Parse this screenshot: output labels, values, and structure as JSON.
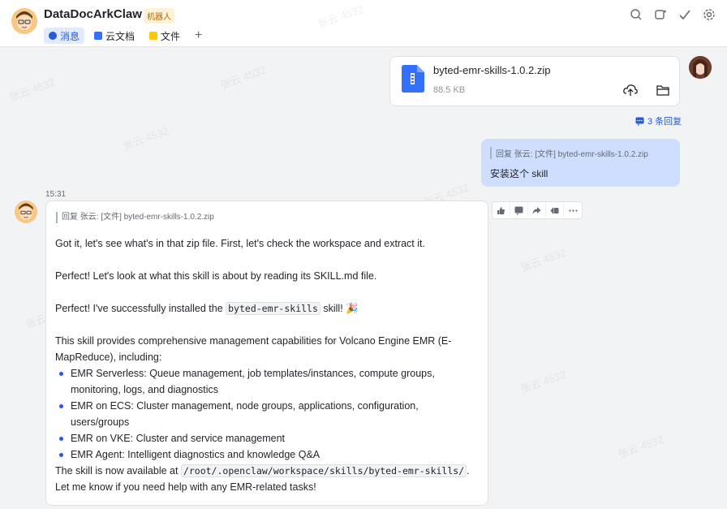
{
  "header": {
    "title": "DataDocArkClaw",
    "badge": "机器人",
    "tabs": [
      {
        "label": "消息",
        "active": true
      },
      {
        "label": "云文档",
        "active": false
      },
      {
        "label": "文件",
        "active": false
      }
    ],
    "add_tab_label": "+"
  },
  "file_message": {
    "name": "byted-emr-skills-1.0.2.zip",
    "size": "88.5 KB",
    "replies_label": "3 条回复"
  },
  "user_message": {
    "quote": "回复 张云: [文件] byted-emr-skills-1.0.2.zip",
    "text": "安装这个 skill"
  },
  "bot_message": {
    "time": "15:31",
    "quote": "回复 张云: [文件] byted-emr-skills-1.0.2.zip",
    "para1": "Got it, let's see what's in that zip file. First, let's check the workspace and extract it.",
    "para2": "Perfect! Let's look at what this skill is about by reading its SKILL.md file.",
    "para3_before": "Perfect! I've successfully installed the ",
    "para3_code": "byted-emr-skills",
    "para3_after": " skill! 🎉",
    "para4": "This skill provides comprehensive management capabilities for Volcano Engine EMR (E-MapReduce), including:",
    "bullets": [
      "EMR Serverless: Queue management, job templates/instances, compute groups, monitoring, logs, and diagnostics",
      "EMR on ECS: Cluster management, node groups, applications, configuration, users/groups",
      "EMR on VKE: Cluster and service management",
      "EMR Agent: Intelligent diagnostics and knowledge Q&A"
    ],
    "para5_before": "The skill is now available at ",
    "para5_code": "/root/.openclaw/workspace/skills/byted-emr-skills/",
    "para5_after": ". Let me know if you need help with any EMR-related tasks!"
  },
  "watermark": "张云 4532",
  "colors": {
    "accent": "#245bdb",
    "user_bubble": "#cfdeff",
    "bg": "#f2f3f5"
  }
}
